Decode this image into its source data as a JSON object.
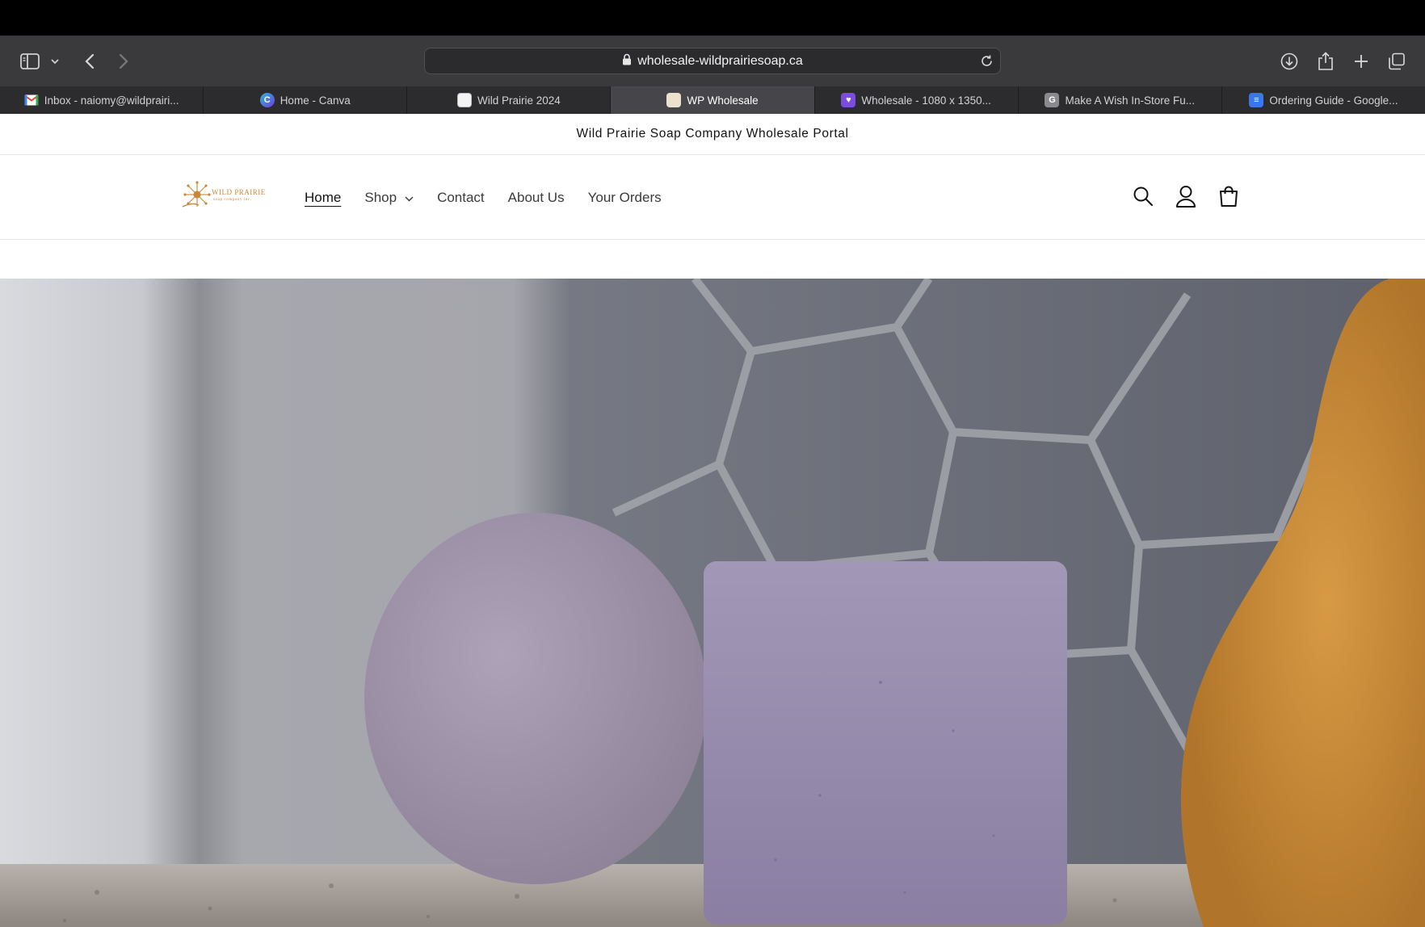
{
  "browser": {
    "url": "wholesale-wildprairiesoap.ca",
    "tabs": [
      {
        "label": "Inbox - naiomy@wildprairi...",
        "favicon": "gmail-icon",
        "color": "#ea4335",
        "glyph": "M",
        "active": false
      },
      {
        "label": "Home - Canva",
        "favicon": "canva-icon",
        "color": "#4b6cf0",
        "glyph": "C",
        "active": false
      },
      {
        "label": "Wild Prairie 2024",
        "favicon": "site-icon",
        "color": "#f0f0f0",
        "glyph": "",
        "active": false
      },
      {
        "label": "WP Wholesale",
        "favicon": "wp-icon",
        "color": "#e9dcc8",
        "glyph": "",
        "active": true
      },
      {
        "label": "Wholesale - 1080 x 1350...",
        "favicon": "heart-icon",
        "color": "#7b4ce0",
        "glyph": "♥",
        "active": false
      },
      {
        "label": "Make A Wish In-Store Fu...",
        "favicon": "google-g-icon",
        "color": "#8a8a8e",
        "glyph": "G",
        "active": false
      },
      {
        "label": "Ordering Guide - Google...",
        "favicon": "docs-icon",
        "color": "#3b77e8",
        "glyph": "≡",
        "active": false
      }
    ]
  },
  "store": {
    "announcement": "Wild Prairie Soap Company Wholesale Portal",
    "logo_text": "WILD PRAIRIE",
    "logo_subtext": "soap company inc.",
    "nav": [
      {
        "label": "Home",
        "current": true
      },
      {
        "label": "Shop",
        "dropdown": true
      },
      {
        "label": "Contact"
      },
      {
        "label": "About Us"
      },
      {
        "label": "Your Orders"
      }
    ]
  },
  "colors": {
    "accent_logo": "#c9873a",
    "soap_purple": "#9f95b4",
    "loofah": "#c98a33"
  }
}
